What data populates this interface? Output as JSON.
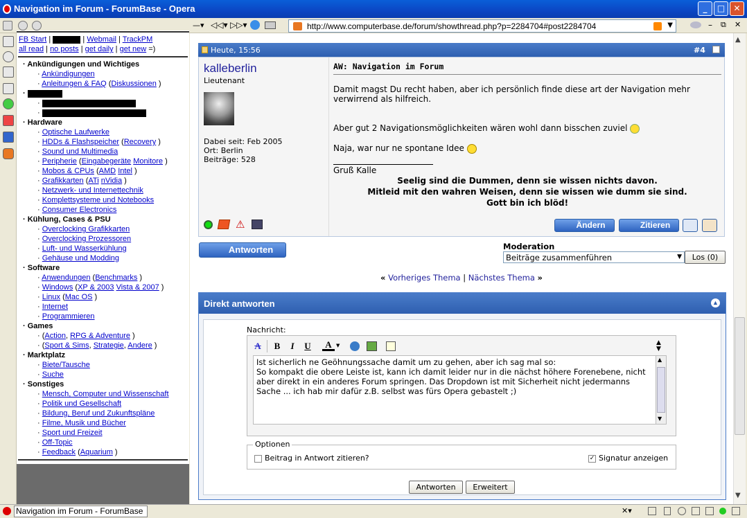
{
  "window": {
    "title": "Navigation im Forum - ForumBase - Opera"
  },
  "toolbar": {
    "url": "http://www.computerbase.de/forum/showthread.php?p=2284704#post2284704"
  },
  "sidebar": {
    "top_links_row1": [
      "FB Start",
      "Webmail",
      "TrackPM"
    ],
    "top_links_row2": [
      "all read",
      "no posts",
      "get daily",
      "get new"
    ],
    "top_suffix": "=)",
    "cat_ankuendigungen": "Ankündigungen und Wichtiges",
    "item_ankuendigungen": "Ankündigungen",
    "item_anleitungen": "Anleitungen & FAQ",
    "item_diskussionen": "Diskussionen",
    "cat_hardware": "Hardware",
    "item_laufwerke": "Optische Laufwerke",
    "item_hdds": "HDDs & Flashspeicher",
    "item_recovery": "Recovery",
    "item_sound": "Sound und Multimedia",
    "item_peripherie": "Peripherie",
    "item_eingabe": "Eingabegeräte",
    "item_monitore": "Monitore",
    "item_mobos": "Mobos & CPUs",
    "item_amd": "AMD",
    "item_intel": "Intel",
    "item_grafik": "Grafikkarten",
    "item_ati": "ATi",
    "item_nvidia": "nVidia",
    "item_netzwerk": "Netzwerk- und Internettechnik",
    "item_komplett": "Komplettsysteme und Notebooks",
    "item_consumer": "Consumer Electronics",
    "cat_kuehlung": "Kühlung, Cases & PSU",
    "item_oc_grafik": "Overclocking Grafikkarten",
    "item_oc_proz": "Overclocking Prozessoren",
    "item_luft": "Luft- und Wasserkühlung",
    "item_gehaeuse": "Gehäuse und Modding",
    "cat_software": "Software",
    "item_anwendungen": "Anwendungen",
    "item_benchmarks": "Benchmarks",
    "item_windows": "Windows",
    "item_xp": "XP & 2003",
    "item_vista": "Vista & 2007",
    "item_linux": "Linux",
    "item_macos": "Mac OS",
    "item_internet": "Internet",
    "item_programmieren": "Programmieren",
    "cat_games": "Games",
    "item_action": "Action",
    "item_rpg": "RPG & Adventure",
    "item_sport": "Sport & Sims",
    "item_strategie": "Strategie",
    "item_andere": "Andere",
    "cat_markt": "Marktplatz",
    "item_biete": "Biete/Tausche",
    "item_suche": "Suche",
    "cat_sonstiges": "Sonstiges",
    "item_mensch": "Mensch, Computer und Wissenschaft",
    "item_politik": "Politik und Gesellschaft",
    "item_bildung": "Bildung, Beruf und Zukunftspläne",
    "item_filme": "Filme, Musik und Bücher",
    "item_sport2": "Sport und Freizeit",
    "item_offtopic": "Off-Topic",
    "item_feedback": "Feedback",
    "item_aquarium": "Aquarium"
  },
  "post": {
    "date": "Heute, 15:56",
    "number": "#4",
    "username": "kalleberlin",
    "rank": "Lieutenant",
    "joined": "Dabei seit: Feb 2005",
    "location": "Ort: Berlin",
    "posts": "Beiträge: 528",
    "title": "AW: Navigation im Forum",
    "para1": "Damit magst Du recht haben, aber ich persönlich finde diese art der Navigation mehr verwirrend als hilfreich.",
    "para2": "Aber gut 2 Navigationsmöglichkeiten wären wohl dann bisschen zuviel",
    "para3": "Naja, war nur ne spontane Idee",
    "greeting": "Gruß Kalle",
    "sig1": "Seelig sind die Dummen, denn sie wissen nichts davon.",
    "sig2": "Mitleid mit den wahren Weisen, denn sie wissen wie dumm sie sind.",
    "sig3": "Gott bin ich blöd!",
    "edit_label": "Ändern",
    "quote_label": "Zitieren"
  },
  "actions": {
    "reply_label": "Antworten",
    "moderation_label": "Moderation",
    "moderation_selected": "Beiträge zusammenführen",
    "go_label": "Los (0)",
    "prev_thread": "Vorheriges Thema",
    "separator": "|",
    "next_thread": "Nächstes Thema"
  },
  "quickreply": {
    "header": "Direkt antworten",
    "message_label": "Nachricht:",
    "message_text": "Ist sicherlich ne Geöhnungssache damit um zu gehen, aber ich sag mal so:\nSo kompakt die obere Leiste ist, kann ich damit leider nur in die nächst höhere Forenebene, nicht aber direkt in ein anderes Forum springen. Das Dropdown ist mit Sicherheit nicht jedermanns Sache ... ich hab mir dafür z.B. selbst was fürs Opera gebastelt ;)",
    "options_legend": "Optionen",
    "quote_option": "Beitrag in Antwort zitieren?",
    "signature_option": "Signatur anzeigen",
    "submit_label": "Antworten",
    "advanced_label": "Erweitert"
  },
  "statusbar": {
    "tab_title": "Navigation im Forum - ForumBase"
  }
}
